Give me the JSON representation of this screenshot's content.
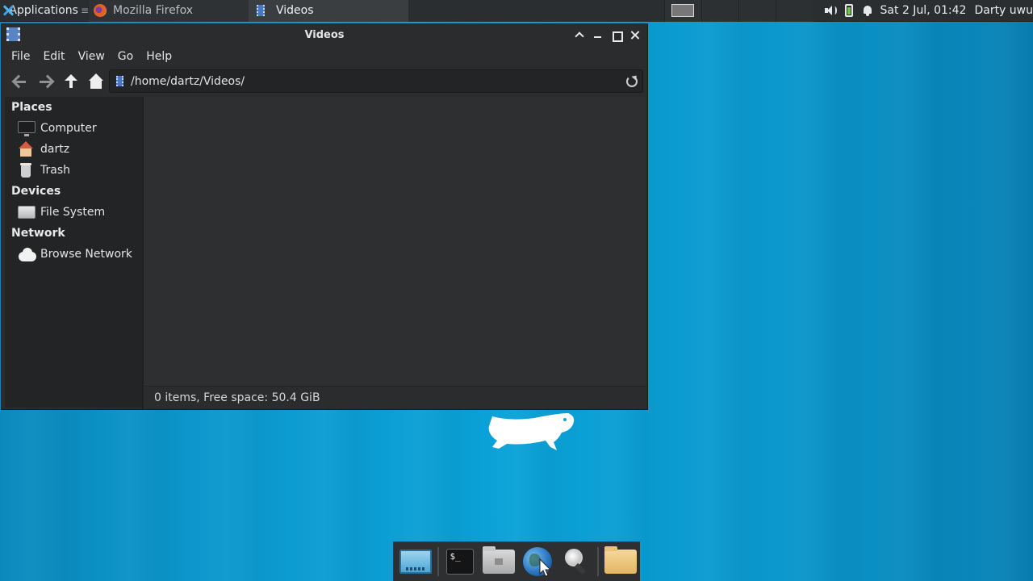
{
  "top_panel": {
    "applications_label": "Applications",
    "tasks": [
      {
        "label": "Mozilla Firefox",
        "icon": "firefox-icon",
        "active": false
      },
      {
        "label": "Videos",
        "icon": "folder-videos-icon",
        "active": true
      }
    ],
    "tray": {
      "clock": "Sat  2 Jul, 01:42",
      "user": "Darty uwu"
    }
  },
  "window": {
    "title": "Videos",
    "menu": [
      "File",
      "Edit",
      "View",
      "Go",
      "Help"
    ],
    "location": "/home/dartz/Videos/",
    "sidebar": {
      "places_heading": "Places",
      "places": [
        "Computer",
        "dartz",
        "Trash"
      ],
      "devices_heading": "Devices",
      "devices": [
        "File System"
      ],
      "network_heading": "Network",
      "network": [
        "Browse Network"
      ]
    },
    "status": "0 items, Free space: 50.4 GiB"
  },
  "dock": {
    "items": [
      "desktop-icon",
      "terminal-icon",
      "home-folder-icon",
      "web-browser-globe-icon",
      "search-icon",
      "folder-icon"
    ],
    "terminal_glyph": "$_"
  },
  "colors": {
    "desktop": "#0aa2d8",
    "panel": "#2b2e30",
    "window": "#2b2c2e",
    "sidebar": "#232425"
  }
}
